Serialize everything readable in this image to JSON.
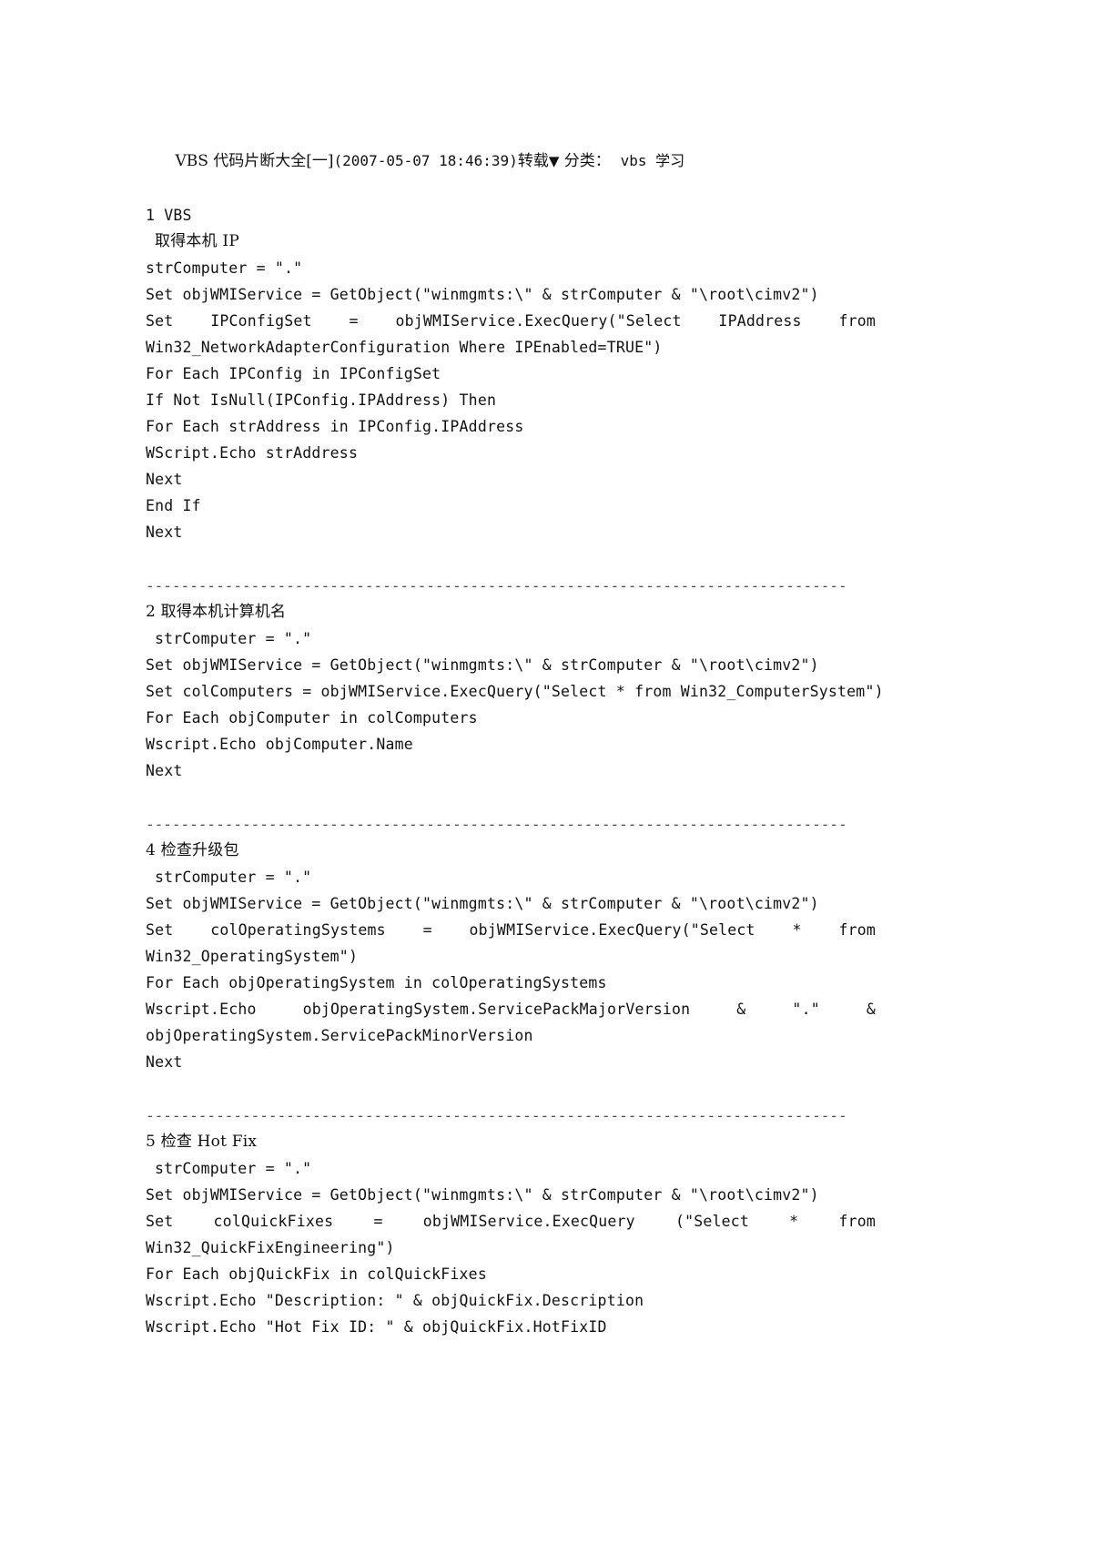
{
  "document": {
    "header": {
      "title": "VBS 代码片断大全[一]",
      "timestamp": "(2007-05-07 18:46:39)",
      "repost_label": "转载",
      "repost_icon": "▼",
      "category_label": "分类：",
      "category_value": "vbs 学习",
      "full_line": "VBS 代码片断大全[一](2007-05-07 18:46:39)转载▼ 分类： vbs 学习"
    },
    "sections": [
      {
        "number": "1",
        "title": "VBS",
        "subtitle": "取得本机 IP",
        "lines": [
          {
            "text": "strComputer = \".\"",
            "justified": false
          },
          {
            "text": "Set objWMIService = GetObject(\"winmgmts:\\\" & strComputer & \"\\root\\cimv2\")",
            "justified": false
          },
          {
            "text": "Set IPConfigSet = objWMIService.ExecQuery(\"Select IPAddress from",
            "justified": true
          },
          {
            "text": "Win32_NetworkAdapterConfiguration Where IPEnabled=TRUE\")",
            "justified": false
          },
          {
            "text": "For Each IPConfig in IPConfigSet",
            "justified": false
          },
          {
            "text": "If Not IsNull(IPConfig.IPAddress) Then",
            "justified": false
          },
          {
            "text": "For Each strAddress in IPConfig.IPAddress",
            "justified": false
          },
          {
            "text": "WScript.Echo strAddress",
            "justified": false
          },
          {
            "text": "Next",
            "justified": false
          },
          {
            "text": "End If",
            "justified": false
          },
          {
            "text": "Next",
            "justified": false
          }
        ]
      },
      {
        "number": "2",
        "title": "取得本机计算机名",
        "subtitle": "",
        "lines": [
          {
            "text": "strComputer = \".\"",
            "justified": false
          },
          {
            "text": "Set objWMIService = GetObject(\"winmgmts:\\\" & strComputer & \"\\root\\cimv2\")",
            "justified": false
          },
          {
            "text": "Set colComputers = objWMIService.ExecQuery(\"Select * from Win32_ComputerSystem\")",
            "justified": false
          },
          {
            "text": "For Each objComputer in colComputers",
            "justified": false
          },
          {
            "text": "Wscript.Echo objComputer.Name",
            "justified": false
          },
          {
            "text": "Next",
            "justified": false
          }
        ]
      },
      {
        "number": "4",
        "title": "检查升级包",
        "subtitle": "",
        "lines": [
          {
            "text": "strComputer = \".\"",
            "justified": false
          },
          {
            "text": "Set objWMIService = GetObject(\"winmgmts:\\\" & strComputer & \"\\root\\cimv2\")",
            "justified": false
          },
          {
            "text": "Set colOperatingSystems = objWMIService.ExecQuery(\"Select * from",
            "justified": true
          },
          {
            "text": "Win32_OperatingSystem\")",
            "justified": false
          },
          {
            "text": "For Each objOperatingSystem in colOperatingSystems",
            "justified": false
          },
          {
            "text": "Wscript.Echo objOperatingSystem.ServicePackMajorVersion & \".\" &",
            "justified": true
          },
          {
            "text": "objOperatingSystem.ServicePackMinorVersion",
            "justified": false
          },
          {
            "text": "Next",
            "justified": false
          }
        ]
      },
      {
        "number": "5",
        "title": "检查 Hot Fix",
        "subtitle": "",
        "lines": [
          {
            "text": "strComputer = \".\"",
            "justified": false
          },
          {
            "text": "Set objWMIService = GetObject(\"winmgmts:\\\" & strComputer & \"\\root\\cimv2\")",
            "justified": false
          },
          {
            "text": "Set colQuickFixes = objWMIService.ExecQuery (\"Select * from",
            "justified": true
          },
          {
            "text": "Win32_QuickFixEngineering\")",
            "justified": false
          },
          {
            "text": "For Each objQuickFix in colQuickFixes",
            "justified": false
          },
          {
            "text": "Wscript.Echo \"Description: \" & objQuickFix.Description",
            "justified": false
          },
          {
            "text": "Wscript.Echo \"Hot Fix ID: \" & objQuickFix.HotFixID",
            "justified": false
          }
        ]
      }
    ],
    "divider_text": "--------------------------------------------------------------------------------"
  }
}
